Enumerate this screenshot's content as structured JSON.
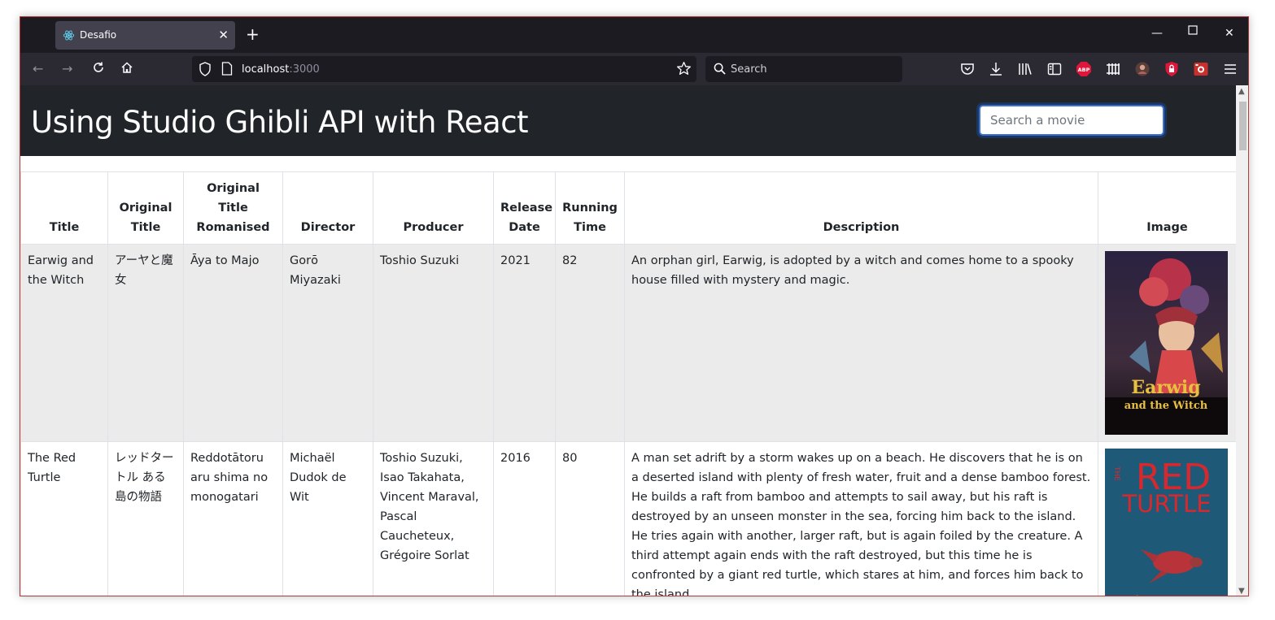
{
  "browser": {
    "tab_title": "Desafio",
    "url_host": "localhost",
    "url_port": ":3000",
    "search_placeholder": "Search",
    "addons": [
      "pocket-icon",
      "download-icon",
      "library-icon",
      "sidebar-icon",
      "adblock-icon",
      "extension-icon",
      "avatar-icon",
      "ublock-icon",
      "snapshot-icon",
      "menu-icon"
    ]
  },
  "header": {
    "title": "Using Studio Ghibli API with React",
    "search_placeholder": "Search a movie"
  },
  "table": {
    "columns": {
      "title": "Title",
      "original_title": "Original Title",
      "original_title_romanised": "Original Title Romanised",
      "director": "Director",
      "producer": "Producer",
      "release_date": "Release Date",
      "running_time": "Running Time",
      "description": "Description",
      "image": "Image"
    },
    "rows": [
      {
        "title": "Earwig and the Witch",
        "original_title": "アーヤと魔女",
        "original_title_romanised": "Āya to Majo",
        "director": "Gorō Miyazaki",
        "producer": "Toshio Suzuki",
        "release_date": "2021",
        "running_time": "82",
        "description": "An orphan girl, Earwig, is adopted by a witch and comes home to a spooky house filled with mystery and magic.",
        "poster_text_1": "Earwig",
        "poster_text_2": "and the Witch",
        "poster_colors": [
          "#3a2a4a",
          "#c8a040"
        ]
      },
      {
        "title": "The Red Turtle",
        "original_title": "レッドタートル ある島の物語",
        "original_title_romanised": "Reddotātoru aru shima no monogatari",
        "director": "Michaël Dudok de Wit",
        "producer": "Toshio Suzuki, Isao Takahata, Vincent Maraval, Pascal Caucheteux, Grégoire Sorlat",
        "release_date": "2016",
        "running_time": "80",
        "description": "A man set adrift by a storm wakes up on a beach. He discovers that he is on a deserted island with plenty of fresh water, fruit and a dense bamboo forest. He builds a raft from bamboo and attempts to sail away, but his raft is destroyed by an unseen monster in the sea, forcing him back to the island. He tries again with another, larger raft, but is again foiled by the creature. A third attempt again ends with the raft destroyed, but this time he is confronted by a giant red turtle, which stares at him, and forces him back to the island.",
        "poster_text_1": "THE",
        "poster_text_2": "RED",
        "poster_text_3": "TURTLE",
        "poster_colors": [
          "#1e5a78",
          "#d8282e"
        ]
      }
    ]
  }
}
